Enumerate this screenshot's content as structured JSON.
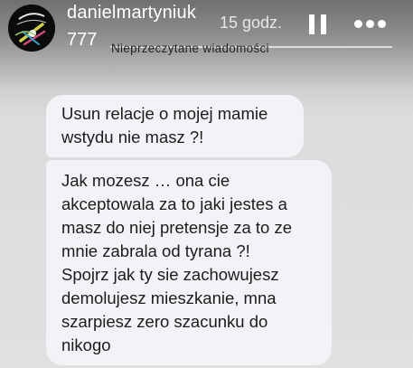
{
  "story_header": {
    "username": "danielmartyniuk",
    "time_ago": "15 godz.",
    "subtitle": "777",
    "song_label": "Nieprzeczytane wiadomości",
    "icons": {
      "pause": "pause-icon",
      "more": "more-icon"
    },
    "colors": {
      "header_text": "#ffffff",
      "background": "#e0e0e0"
    }
  },
  "messages": [
    {
      "text": "Usun relacje o mojej mamie\nwstydu nie masz ?!"
    },
    {
      "text": "Jak mozesz … ona cie\nakceptowala za to jaki jestes a\nmasz do niej pretensje za to ze\nmnie zabrala od tyrana ?!\nSpojrz jak ty sie zachowujesz\ndemolujesz mieszkanie, mna\nszarpiesz zero szacunku do\nnikogo"
    }
  ],
  "bubble_color": "#f2f3f6"
}
